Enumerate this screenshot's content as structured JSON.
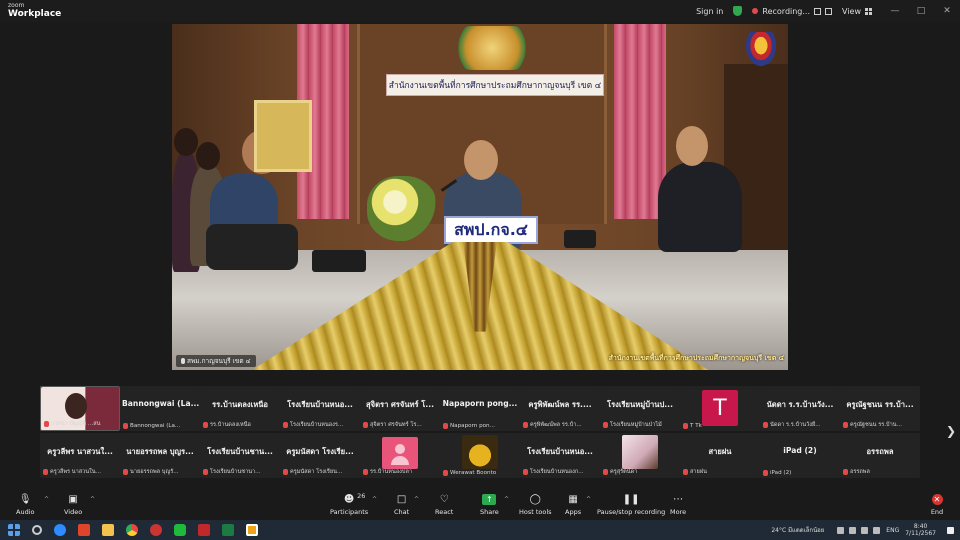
{
  "app": {
    "brand_line1": "zoom",
    "brand_line2": "Workplace",
    "sign_in": "Sign in",
    "recording": "Recording...",
    "view": "View"
  },
  "video": {
    "wall_sign": "สำนักงานเขตพื้นที่การศึกษาประถมศึกษากาญจนบุรี เขต ๔",
    "nameplate": "สพป.กจ.๔",
    "participant_label": "สพม.กาญจนบุรี เขต ๔",
    "ticker": "สำนักงานเขตพื้นที่การศึกษาประถมศึกษากาญจนบุรี เขต ๔"
  },
  "gallery": {
    "row1": [
      {
        "name": "",
        "sub": "วาสนา บัญญัติ ...สน",
        "kind": "photo",
        "color": "#7a2a3a"
      },
      {
        "name": "Bannongwai (La...",
        "sub": "Bannongwai (La...",
        "kind": "name"
      },
      {
        "name": "รร.บ้านดลงเหนือ",
        "sub": "รร.บ้านดลงเหนือ",
        "kind": "name"
      },
      {
        "name": "โรงเรียนบ้านหนอ...",
        "sub": "โรงเรียนบ้านหนองร...",
        "kind": "name"
      },
      {
        "name": "สุจิตรา ศรจันทร์ โ...",
        "sub": "สุจิตรา ศรจันทร์ โร...",
        "kind": "name"
      },
      {
        "name": "Napaporn pong...",
        "sub": "Napaporn pon...",
        "kind": "name"
      },
      {
        "name": "ครูพิพัฒน์พล รร....",
        "sub": "ครูพิพัฒน์พล รร.บ้า...",
        "kind": "name"
      },
      {
        "name": "โรงเรียนหมู่บ้านป...",
        "sub": "โรงเรียนหมู่บ้านป่าไม้",
        "kind": "name"
      },
      {
        "name": "",
        "sub": "T Tk",
        "kind": "letter",
        "letter": "T"
      },
      {
        "name": "นัดดา ร.ร.บ้านวัง...",
        "sub": "นัดดา ร.ร.บ้านวังยี่...",
        "kind": "name"
      },
      {
        "name": "ครูณัฐชนน รร.บ้า...",
        "sub": "ครูณัฐชนน รร.บ้าน...",
        "kind": "name"
      }
    ],
    "row2": [
      {
        "name": "ครูวลีพร นาสวนใ...",
        "sub": "ครูวลีพร นาสวนใน...",
        "kind": "name"
      },
      {
        "name": "นายอรรถพล บุญร...",
        "sub": "นายอรรถพล บุญรั...",
        "kind": "name"
      },
      {
        "name": "โรงเรียนบ้านชาน...",
        "sub": "โรงเรียนบ้านชานา...",
        "kind": "name"
      },
      {
        "name": "ครูมนัสดา โรงเรีย...",
        "sub": "ครูมนัสดา โรงเรียน...",
        "kind": "name"
      },
      {
        "name": "",
        "sub": "รร.บ้านหนองปลา",
        "kind": "generic"
      },
      {
        "name": "",
        "sub": "Werawat Boonto",
        "kind": "photo",
        "color": "#d9a21b"
      },
      {
        "name": "โรงเรียนบ้านหนอ...",
        "sub": "โรงเรียนบ้านหนองก...",
        "kind": "name"
      },
      {
        "name": "",
        "sub": "ครูสุรัตน์ดา",
        "kind": "photo",
        "color": "#e8c9d0"
      },
      {
        "name": "สายฝน",
        "sub": "สายฝน",
        "kind": "name"
      },
      {
        "name": "iPad (2)",
        "sub": "iPad (2)",
        "kind": "name"
      },
      {
        "name": "อรรถพล",
        "sub": "อรรถพล",
        "kind": "name"
      }
    ]
  },
  "toolbar": {
    "audio": "Audio",
    "video": "Video",
    "participants": "Participants",
    "participants_count": "26",
    "chat": "Chat",
    "react": "React",
    "share": "Share",
    "host_tools": "Host tools",
    "apps": "Apps",
    "pause_recording": "Pause/stop recording",
    "more": "More",
    "end": "End"
  },
  "taskbar": {
    "weather": "24°C  มีแดดเล็กน้อย",
    "lang": "ENG",
    "time": "8:40",
    "date": "7/11/2567"
  },
  "colors": {
    "accent_share": "#2da94f",
    "end_red": "#d9352e",
    "avatar_t": "#c8174b"
  }
}
